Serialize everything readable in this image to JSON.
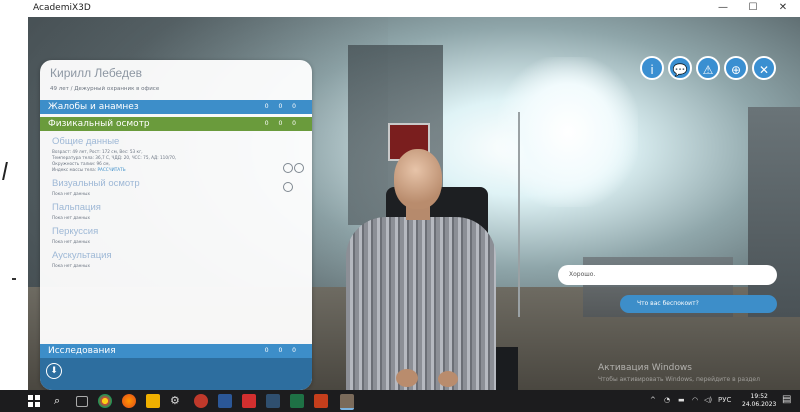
{
  "window": {
    "title": "AcademiX3D",
    "controls": [
      "—",
      "☐",
      "✕"
    ]
  },
  "patient": {
    "name": "Кирилл Лебедев",
    "info": "49 лет / Дежурный охранник в офисе"
  },
  "sections": {
    "complaints": {
      "label": "Жалобы и анамнез",
      "scores": "0 0 0"
    },
    "exam": {
      "label": "Физикальный осмотр",
      "scores": "0 0 0"
    },
    "research": {
      "label": "Исследования",
      "scores": "0 0 0"
    }
  },
  "exam_details": {
    "general": {
      "title": "Общие данные",
      "line1": "Возраст: 49 лет, Рост: 172 см, Вес: 53 кг,",
      "line2": "Температура тела: 36,7 С, ЧДД: 20, ЧСС: 75, АД: 110/70,",
      "line3": "Окружность талии: 96 см,",
      "line4_prefix": "Индекс массы тела:",
      "line4_link": "РАССЧИТАТЬ"
    },
    "visual": {
      "title": "Визуальный осмотр",
      "empty": "Пока нет данных"
    },
    "palpation": {
      "title": "Пальпация",
      "empty": "Пока нет данных"
    },
    "percussion": {
      "title": "Перкуссия",
      "empty": "Пока нет данных"
    },
    "auscultation": {
      "title": "Аускультация",
      "empty": "Пока нет данных"
    }
  },
  "top_buttons": [
    {
      "name": "info-button",
      "glyph": "i"
    },
    {
      "name": "chat-button",
      "glyph": "💬"
    },
    {
      "name": "warning-button",
      "glyph": "⚠"
    },
    {
      "name": "options-button",
      "glyph": "⊕"
    },
    {
      "name": "close-scene-button",
      "glyph": "✕"
    }
  ],
  "dialogue": {
    "reply": "Хорошо.",
    "option": "Что вас беспокоит?"
  },
  "watermark": {
    "line1": "Активация Windows",
    "line2": "Чтобы активировать Windows, перейдите в раздел"
  },
  "taskbar": {
    "lang": "РУС",
    "time": "19:52",
    "date": "24.06.2023"
  },
  "colors": {
    "accent_blue": "#3d8ec9",
    "exam_green": "#6a9b3c",
    "footer_blue": "#2d6e9f"
  }
}
